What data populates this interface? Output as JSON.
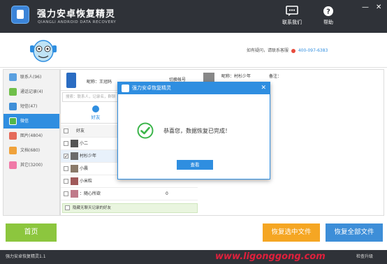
{
  "app": {
    "title": "强力安卓恢复精灵",
    "subtitle": "QIANGLI ANDROID DATA RECOVERY",
    "contact_btn": "联系我们",
    "help_btn": "帮助",
    "minimize": "—",
    "close": "✕"
  },
  "banner": {
    "contact_text": "如有疑问，请联系客服",
    "phone": "400-097-6383"
  },
  "sidebar": {
    "items": [
      {
        "label": "联系人(96)",
        "color": "#5aa0e0"
      },
      {
        "label": "通话记录(4)",
        "color": "#6fbf4a"
      },
      {
        "label": "短信(47)",
        "color": "#3f8fd8"
      },
      {
        "label": "微信",
        "color": "#52b64a"
      },
      {
        "label": "图片(4804)",
        "color": "#e56a5a"
      },
      {
        "label": "文档(680)",
        "color": "#f0a23b"
      },
      {
        "label": "其它(3200)",
        "color": "#f07aa8"
      }
    ],
    "active_index": 3
  },
  "contacts_panel": {
    "nickname": "昵称：王冠码",
    "switch_account": "切换帐号",
    "search_placeholder": "搜索：联系人，记录名，群聊",
    "tab_friends": "好友",
    "column_friends": "好友",
    "rows": [
      {
        "name": "小二",
        "count": "",
        "checked": false
      },
      {
        "name": "村杉少年",
        "count": "",
        "checked": true
      },
      {
        "name": "小晨",
        "count": "",
        "checked": false
      },
      {
        "name": "小米粒",
        "count": "",
        "checked": false
      },
      {
        "name": "：随心所欲",
        "count": "0",
        "checked": false
      }
    ],
    "hide_no_chat": "隐藏无聊天记录的好友"
  },
  "chat_panel": {
    "nickname": "昵称：村杉少年",
    "note": "备注："
  },
  "dialog": {
    "title": "强力安卓恢复精灵",
    "close": "✕",
    "message": "恭喜您，数据恢复已完成！",
    "button": "查看"
  },
  "bottom": {
    "home": "首页",
    "recover_selected": "恢复选中文件",
    "recover_all": "恢复全部文件"
  },
  "statusbar": {
    "version": "强力安卓恢复精灵1.1",
    "watermark": "www.ligonggong.com",
    "update": "检查升级"
  }
}
